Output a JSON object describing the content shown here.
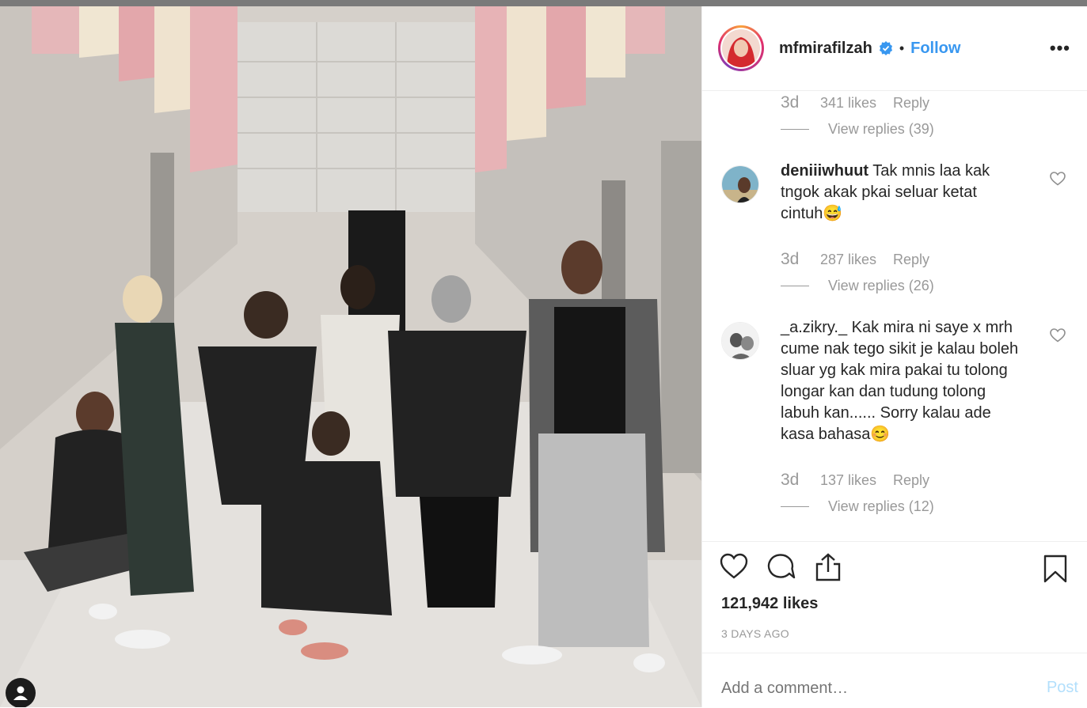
{
  "post": {
    "username": "mfmirafilzah",
    "verified": true,
    "follow_label": "Follow",
    "separator": "•",
    "more_label": "•••",
    "like_count": "121,942 likes",
    "date": "3 DAYS AGO",
    "add_comment_placeholder": "Add a comment…",
    "post_label": "Post"
  },
  "comments": [
    {
      "partial": true,
      "time": "3d",
      "likes": "341 likes",
      "reply": "Reply",
      "view_replies": "View replies (39)"
    },
    {
      "username": "deniiiwhuut",
      "text": " Tak mnis laa kak tngok akak pkai seluar ketat cintuh😅",
      "time": "3d",
      "likes": "287 likes",
      "reply": "Reply",
      "view_replies": "View replies (26)"
    },
    {
      "username": "_a.zikry._",
      "text": " Kak mira ni saye x mrh cume nak tego sikit je kalau boleh sluar yg kak mira pakai tu tolong longar kan dan tudung tolong labuh kan...... Sorry kalau ade kasa bahasa😊",
      "time": "3d",
      "likes": "137 likes",
      "reply": "Reply",
      "view_replies": "View replies (12)"
    }
  ],
  "colors": {
    "link_blue": "#3897f0",
    "muted": "#999999",
    "post_disabled": "#b2dffc"
  },
  "icons": [
    "heart-icon",
    "comment-icon",
    "share-icon",
    "bookmark-icon",
    "verified-badge-icon",
    "user-icon"
  ]
}
